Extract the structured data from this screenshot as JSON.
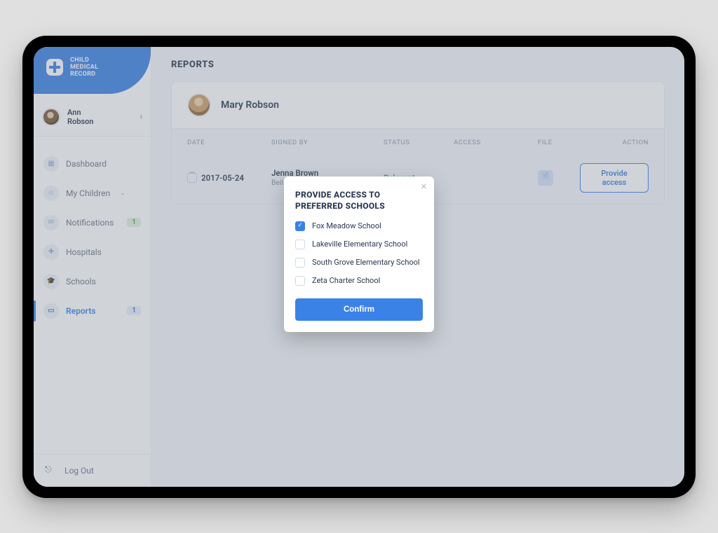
{
  "brand": {
    "line1": "CHILD",
    "line2": "MEDICAL",
    "line3": "RECORD"
  },
  "user": {
    "first": "Ann",
    "last": "Robson"
  },
  "nav": {
    "dashboard": "Dashboard",
    "children": "My Children",
    "notifications": "Notifications",
    "notifications_badge": "1",
    "hospitals": "Hospitals",
    "schools": "Schools",
    "reports": "Reports",
    "reports_badge": "1",
    "logout": "Log Out"
  },
  "page": {
    "title": "REPORTS"
  },
  "patient": {
    "name": "Mary Robson"
  },
  "table": {
    "headers": {
      "date": "DATE",
      "signed": "SIGNED BY",
      "status": "STATUS",
      "access": "ACCESS",
      "file": "FILE",
      "action": "ACTION"
    },
    "rows": [
      {
        "date": "2017-05-24",
        "signer": "Jenna Brown",
        "signer_org": "Bellevue Hospital Center",
        "status": "Relevant",
        "action_label": "Provide access"
      }
    ]
  },
  "modal": {
    "title": "PROVIDE ACCESS TO PREFERRED SCHOOLS",
    "options": [
      {
        "label": "Fox Meadow School",
        "checked": true
      },
      {
        "label": "Lakeville Elementary School",
        "checked": false
      },
      {
        "label": "South Grove Elementary School",
        "checked": false
      },
      {
        "label": "Zeta Charter School",
        "checked": false
      }
    ],
    "confirm": "Confirm"
  }
}
